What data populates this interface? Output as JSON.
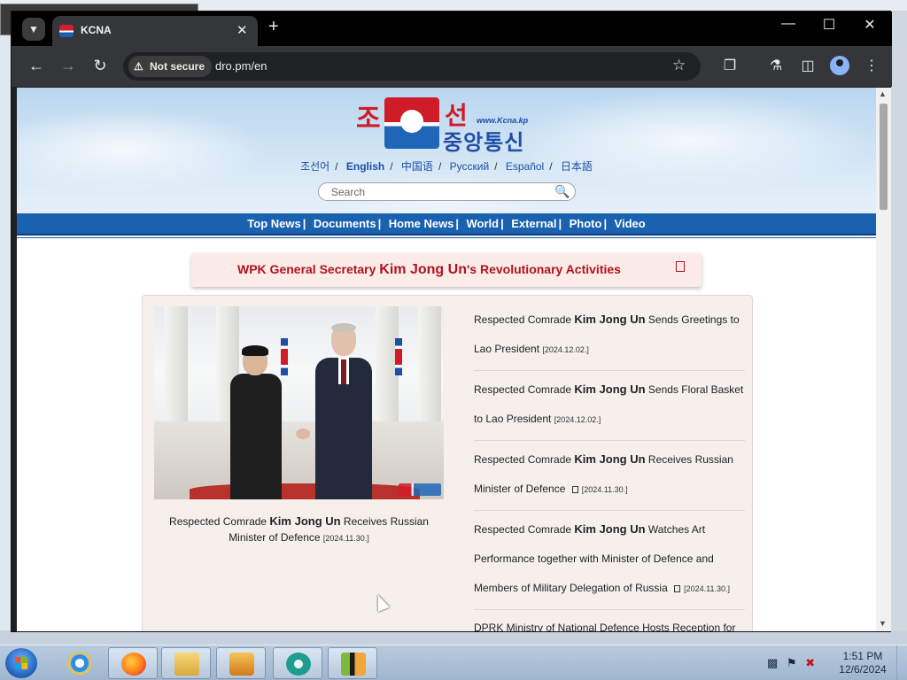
{
  "browser": {
    "tab_title": "KCNA",
    "security_label": "Not secure",
    "url": "dro.pm/en"
  },
  "site": {
    "logo_korean_top_left": "조",
    "logo_korean_top_right": "선",
    "logo_korean_bottom": "중앙통신",
    "logo_url": "www.Kcna.kp",
    "languages": [
      "조선어",
      "English",
      "中国语",
      "Русский",
      "Español",
      "日本語"
    ],
    "active_language": "English",
    "lang_separator": "/",
    "search_placeholder": "Search",
    "nav": [
      "Top News",
      "Documents",
      "Home News",
      "World",
      "External",
      "Photo",
      "Video"
    ],
    "nav_separator": "|",
    "banner": {
      "prefix": "WPK General Secretary ",
      "name": "Kim Jong Un",
      "suffix": "'s Revolutionary Activities"
    },
    "featured": {
      "prefix": "Respected Comrade ",
      "name": "Kim Jong Un",
      "suffix": " Receives Russian Minister of Defence ",
      "date": "[2024.11.30.]"
    },
    "news": [
      {
        "prefix": "Respected Comrade ",
        "name": "Kim Jong Un",
        "suffix": " Sends Greetings to Lao President ",
        "date": "[2024.12.02.]",
        "icon": false
      },
      {
        "prefix": "Respected Comrade ",
        "name": "Kim Jong Un",
        "suffix": " Sends Floral Basket to Lao President ",
        "date": "[2024.12.02.]",
        "icon": false
      },
      {
        "prefix": "Respected Comrade ",
        "name": "Kim Jong Un",
        "suffix": " Receives Russian Minister of Defence ",
        "date": "[2024.11.30.]",
        "icon": true
      },
      {
        "prefix": "Respected Comrade ",
        "name": "Kim Jong Un",
        "suffix": " Watches Art Performance together with Minister of Defence and Members of Military Delegation of Russia ",
        "date": "[2024.11.30.]",
        "icon": true
      },
      {
        "prefix": "DPRK Ministry of National Defence Hosts Reception for",
        "name": "",
        "suffix": "",
        "date": "",
        "icon": false
      }
    ]
  },
  "taskbar": {
    "apps": [
      "internet-explorer",
      "firefox",
      "file-explorer",
      "media-player",
      "chrome",
      "hxd"
    ],
    "time": "1:51 PM",
    "date": "12/6/2024"
  },
  "colors": {
    "nav_blue": "#1a62b0",
    "banner_red": "#b3121c",
    "chrome_dark": "#35363a"
  }
}
